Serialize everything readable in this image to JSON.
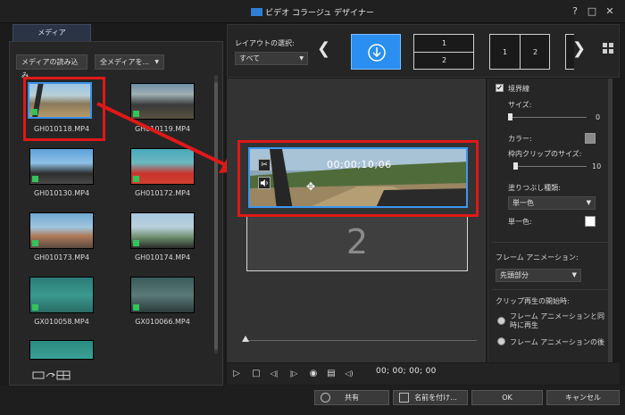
{
  "window": {
    "title": "ビデオ コラージュ デザイナー",
    "help": "?",
    "maximize": "□",
    "close": "✕"
  },
  "media": {
    "tab": "メディア",
    "import_button": "メディアの読み込み",
    "filter_dropdown": "全メディアを...",
    "filter_caret": "▼",
    "items": [
      {
        "label": "GH010118.MP4"
      },
      {
        "label": "GH010119.MP4"
      },
      {
        "label": "GH010130.MP4"
      },
      {
        "label": "GH010172.MP4"
      },
      {
        "label": "GH010173.MP4"
      },
      {
        "label": "GH010174.MP4"
      },
      {
        "label": "GX010058.MP4"
      },
      {
        "label": "GX010066.MP4"
      }
    ]
  },
  "layout": {
    "label": "レイアウトの選択:",
    "select_value": "すべて",
    "select_caret": "▼",
    "prev": "❮",
    "next": "❯",
    "opt2_top": "1",
    "opt2_bottom": "2",
    "opt3_left": "1",
    "opt3_right": "2"
  },
  "preview": {
    "timecode": "00;00;10;06",
    "slot2_number": "2",
    "scissors": "✂",
    "speaker": "🔊",
    "move": "✥"
  },
  "properties": {
    "border_label": "境界線",
    "size_label": "サイズ:",
    "size_value": "0",
    "color_label": "カラー:",
    "inner_border_label": "枠内クリップのサイズ:",
    "inner_border_value": "10",
    "fill_type_label": "塗りつぶし種類:",
    "fill_type_value": "単一色",
    "single_color_label": "単一色:",
    "frame_animation_label": "フレーム アニメーション:",
    "frame_animation_value": "先頭部分",
    "clip_start_label": "クリップ再生の開始時:",
    "radio1_label": "フレーム アニメーションと同時に再生",
    "radio2_label": "フレーム アニメーションの後",
    "caret": "▼"
  },
  "transport": {
    "play": "▷",
    "stop": "□",
    "prev_frame": "◁|",
    "next_frame": "|▷",
    "snapshot": "◉",
    "caption": "▤",
    "volume": "◁)",
    "timecode": "00; 00; 00; 00"
  },
  "footer": {
    "share": "共有",
    "save_as": "名前を付け...",
    "ok": "OK",
    "cancel": "キャンセル"
  },
  "colors": {
    "accent": "#2a8ff0",
    "highlight_red": "#e01818",
    "border_swatch": "#8a8a8a",
    "single_color_swatch": "#ffffff"
  }
}
